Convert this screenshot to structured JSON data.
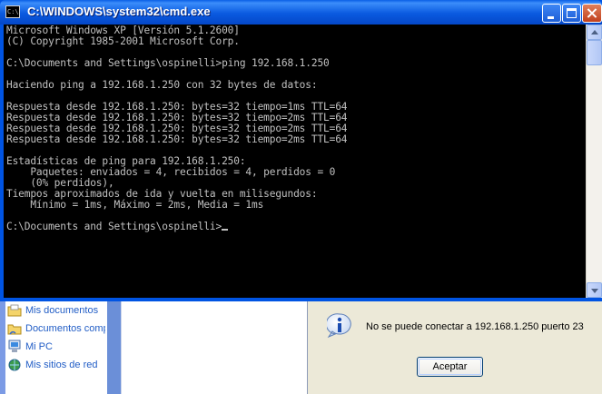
{
  "cmd": {
    "title": "C:\\WINDOWS\\system32\\cmd.exe",
    "icon_text": "C:\\",
    "lines": [
      "Microsoft Windows XP [Versión 5.1.2600]",
      "(C) Copyright 1985-2001 Microsoft Corp.",
      "",
      "C:\\Documents and Settings\\ospinelli>ping 192.168.1.250",
      "",
      "Haciendo ping a 192.168.1.250 con 32 bytes de datos:",
      "",
      "Respuesta desde 192.168.1.250: bytes=32 tiempo=1ms TTL=64",
      "Respuesta desde 192.168.1.250: bytes=32 tiempo=2ms TTL=64",
      "Respuesta desde 192.168.1.250: bytes=32 tiempo=2ms TTL=64",
      "Respuesta desde 192.168.1.250: bytes=32 tiempo=2ms TTL=64",
      "",
      "Estadísticas de ping para 192.168.1.250:",
      "    Paquetes: enviados = 4, recibidos = 4, perdidos = 0",
      "    (0% perdidos),",
      "Tiempos aproximados de ida y vuelta en milisegundos:",
      "    Mínimo = 1ms, Máximo = 2ms, Media = 1ms",
      ""
    ],
    "prompt": "C:\\Documents and Settings\\ospinelli>"
  },
  "places": [
    {
      "label": "Mis documentos",
      "icon": "my-documents-icon"
    },
    {
      "label": "Documentos compartidos",
      "icon": "shared-documents-icon"
    },
    {
      "label": "Mi PC",
      "icon": "my-computer-icon"
    },
    {
      "label": "Mis sitios de red",
      "icon": "network-places-icon"
    }
  ],
  "dialog": {
    "message": "No se puede conectar a 192.168.1.250 puerto 23",
    "ok_label": "Aceptar",
    "icon": "info-icon"
  },
  "colors": {
    "console_bg": "#000000",
    "console_fg": "#c0c0c0",
    "titlebar": "#0a5ae0",
    "dialog_bg": "#ece9d8"
  }
}
